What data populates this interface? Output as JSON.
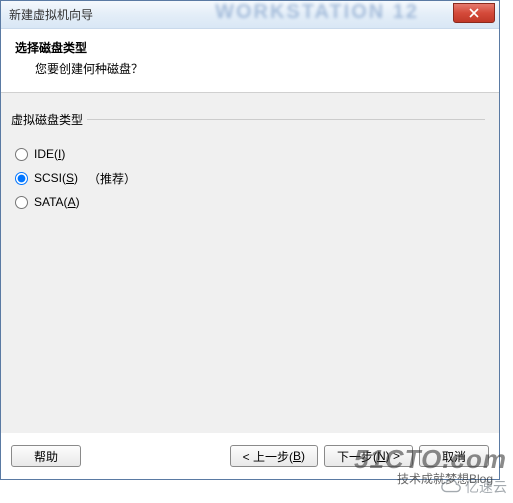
{
  "window": {
    "title": "新建虚拟机向导",
    "bg_text": "WORKSTATION 12"
  },
  "header": {
    "title": "选择磁盘类型",
    "subtitle": "您要创建何种磁盘？"
  },
  "group": {
    "legend": "虚拟磁盘类型",
    "options": [
      {
        "label_pre": "IDE(",
        "accel": "I",
        "label_post": ")",
        "checked": false,
        "rec": ""
      },
      {
        "label_pre": "SCSI(",
        "accel": "S",
        "label_post": ")",
        "checked": true,
        "rec": "（推荐）"
      },
      {
        "label_pre": "SATA(",
        "accel": "A",
        "label_post": ")",
        "checked": false,
        "rec": ""
      }
    ]
  },
  "buttons": {
    "help": "帮助",
    "back_pre": "< 上一步(",
    "back_accel": "B",
    "back_post": ")",
    "next_pre": "下一步(",
    "next_accel": "N",
    "next_post": ") >",
    "cancel": "取消"
  },
  "watermarks": {
    "w1": "51CTO.com",
    "w2": "亿速云",
    "overlap": "技术成就梦想Blog"
  }
}
